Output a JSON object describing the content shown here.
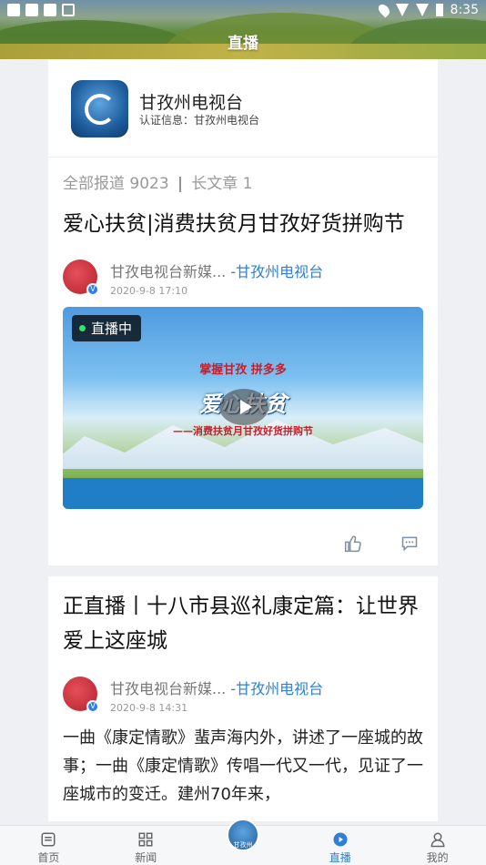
{
  "status_bar": {
    "time": "8:35"
  },
  "header": {
    "title": "直播"
  },
  "profile": {
    "name": "甘孜州电视台",
    "certification": "认证信息：甘孜州电视台"
  },
  "stats": {
    "reports": "全部报道 9023",
    "separator": "|",
    "long_articles": "长文章 1"
  },
  "articles": [
    {
      "title": "爱心扶贫|消费扶贫月甘孜好货拼购节",
      "author": "甘孜电视台新媒...",
      "org": "-甘孜州电视台",
      "date": "2020-9-8 17:10",
      "video": {
        "live_label": "直播中",
        "logo_left": "掌握甘孜",
        "logo_right": "拼多多",
        "banner_title": "爱心扶贫",
        "banner_sub": "——消费扶贫月甘孜好货拼购节"
      }
    },
    {
      "title": "正直播丨十八市县巡礼康定篇：让世界爱上这座城",
      "author": "甘孜电视台新媒...",
      "org": "-甘孜州电视台",
      "date": "2020-9-8 14:31",
      "excerpt": "一曲《康定情歌》蜚声海内外，讲述了一座城的故事；一曲《康定情歌》传唱一代又一代，见证了一座城市的变迁。建州70年来，"
    }
  ],
  "tabbar": {
    "items": [
      {
        "label": "首页",
        "icon": "home-icon"
      },
      {
        "label": "新闻",
        "icon": "grid-icon"
      },
      {
        "label": "甘孜州",
        "icon": "center-logo-icon"
      },
      {
        "label": "直播",
        "icon": "play-circle-icon"
      },
      {
        "label": "我的",
        "icon": "user-icon"
      }
    ],
    "active": "直播"
  }
}
